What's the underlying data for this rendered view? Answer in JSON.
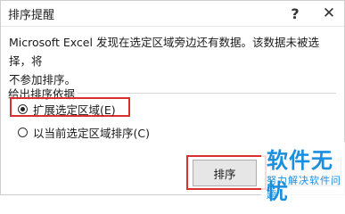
{
  "dialog": {
    "title": "排序提醒",
    "help_icon": "?",
    "close_icon": "✕",
    "message_line1": "Microsoft Excel 发现在选定区域旁边还有数据。该数据未被选择，将",
    "message_line2": "不参加排序。"
  },
  "group": {
    "label": "给出排序依据",
    "options": [
      {
        "label": "扩展选定区域(E)",
        "selected": true
      },
      {
        "label": "以当前选定区域排序(C)",
        "selected": false
      }
    ]
  },
  "buttons": {
    "sort_label": "排序"
  },
  "watermark": {
    "title": "软件无忧",
    "subtitle": "努力解决软件问题"
  },
  "colors": {
    "highlight": "#d9302e",
    "watermark": "#1a8fe0"
  }
}
